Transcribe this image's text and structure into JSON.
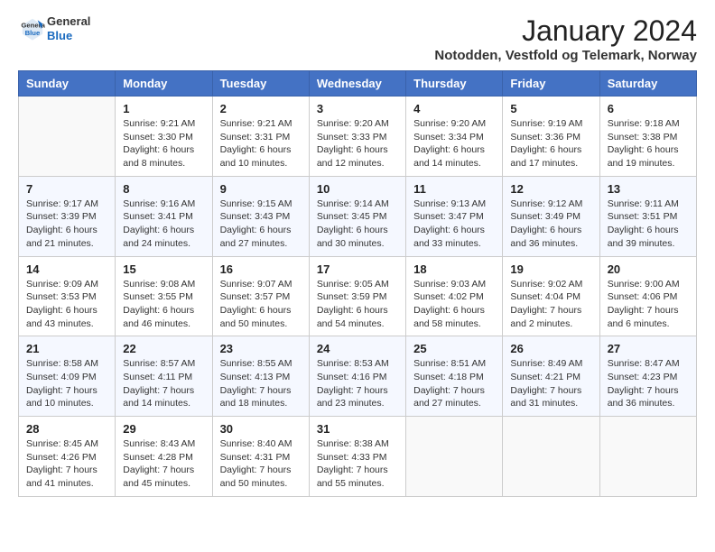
{
  "header": {
    "logo_general": "General",
    "logo_blue": "Blue",
    "title": "January 2024",
    "location": "Notodden, Vestfold og Telemark, Norway"
  },
  "weekdays": [
    "Sunday",
    "Monday",
    "Tuesday",
    "Wednesday",
    "Thursday",
    "Friday",
    "Saturday"
  ],
  "weeks": [
    [
      {
        "day": "",
        "detail": ""
      },
      {
        "day": "1",
        "detail": "Sunrise: 9:21 AM\nSunset: 3:30 PM\nDaylight: 6 hours\nand 8 minutes."
      },
      {
        "day": "2",
        "detail": "Sunrise: 9:21 AM\nSunset: 3:31 PM\nDaylight: 6 hours\nand 10 minutes."
      },
      {
        "day": "3",
        "detail": "Sunrise: 9:20 AM\nSunset: 3:33 PM\nDaylight: 6 hours\nand 12 minutes."
      },
      {
        "day": "4",
        "detail": "Sunrise: 9:20 AM\nSunset: 3:34 PM\nDaylight: 6 hours\nand 14 minutes."
      },
      {
        "day": "5",
        "detail": "Sunrise: 9:19 AM\nSunset: 3:36 PM\nDaylight: 6 hours\nand 17 minutes."
      },
      {
        "day": "6",
        "detail": "Sunrise: 9:18 AM\nSunset: 3:38 PM\nDaylight: 6 hours\nand 19 minutes."
      }
    ],
    [
      {
        "day": "7",
        "detail": "Sunrise: 9:17 AM\nSunset: 3:39 PM\nDaylight: 6 hours\nand 21 minutes."
      },
      {
        "day": "8",
        "detail": "Sunrise: 9:16 AM\nSunset: 3:41 PM\nDaylight: 6 hours\nand 24 minutes."
      },
      {
        "day": "9",
        "detail": "Sunrise: 9:15 AM\nSunset: 3:43 PM\nDaylight: 6 hours\nand 27 minutes."
      },
      {
        "day": "10",
        "detail": "Sunrise: 9:14 AM\nSunset: 3:45 PM\nDaylight: 6 hours\nand 30 minutes."
      },
      {
        "day": "11",
        "detail": "Sunrise: 9:13 AM\nSunset: 3:47 PM\nDaylight: 6 hours\nand 33 minutes."
      },
      {
        "day": "12",
        "detail": "Sunrise: 9:12 AM\nSunset: 3:49 PM\nDaylight: 6 hours\nand 36 minutes."
      },
      {
        "day": "13",
        "detail": "Sunrise: 9:11 AM\nSunset: 3:51 PM\nDaylight: 6 hours\nand 39 minutes."
      }
    ],
    [
      {
        "day": "14",
        "detail": "Sunrise: 9:09 AM\nSunset: 3:53 PM\nDaylight: 6 hours\nand 43 minutes."
      },
      {
        "day": "15",
        "detail": "Sunrise: 9:08 AM\nSunset: 3:55 PM\nDaylight: 6 hours\nand 46 minutes."
      },
      {
        "day": "16",
        "detail": "Sunrise: 9:07 AM\nSunset: 3:57 PM\nDaylight: 6 hours\nand 50 minutes."
      },
      {
        "day": "17",
        "detail": "Sunrise: 9:05 AM\nSunset: 3:59 PM\nDaylight: 6 hours\nand 54 minutes."
      },
      {
        "day": "18",
        "detail": "Sunrise: 9:03 AM\nSunset: 4:02 PM\nDaylight: 6 hours\nand 58 minutes."
      },
      {
        "day": "19",
        "detail": "Sunrise: 9:02 AM\nSunset: 4:04 PM\nDaylight: 7 hours\nand 2 minutes."
      },
      {
        "day": "20",
        "detail": "Sunrise: 9:00 AM\nSunset: 4:06 PM\nDaylight: 7 hours\nand 6 minutes."
      }
    ],
    [
      {
        "day": "21",
        "detail": "Sunrise: 8:58 AM\nSunset: 4:09 PM\nDaylight: 7 hours\nand 10 minutes."
      },
      {
        "day": "22",
        "detail": "Sunrise: 8:57 AM\nSunset: 4:11 PM\nDaylight: 7 hours\nand 14 minutes."
      },
      {
        "day": "23",
        "detail": "Sunrise: 8:55 AM\nSunset: 4:13 PM\nDaylight: 7 hours\nand 18 minutes."
      },
      {
        "day": "24",
        "detail": "Sunrise: 8:53 AM\nSunset: 4:16 PM\nDaylight: 7 hours\nand 23 minutes."
      },
      {
        "day": "25",
        "detail": "Sunrise: 8:51 AM\nSunset: 4:18 PM\nDaylight: 7 hours\nand 27 minutes."
      },
      {
        "day": "26",
        "detail": "Sunrise: 8:49 AM\nSunset: 4:21 PM\nDaylight: 7 hours\nand 31 minutes."
      },
      {
        "day": "27",
        "detail": "Sunrise: 8:47 AM\nSunset: 4:23 PM\nDaylight: 7 hours\nand 36 minutes."
      }
    ],
    [
      {
        "day": "28",
        "detail": "Sunrise: 8:45 AM\nSunset: 4:26 PM\nDaylight: 7 hours\nand 41 minutes."
      },
      {
        "day": "29",
        "detail": "Sunrise: 8:43 AM\nSunset: 4:28 PM\nDaylight: 7 hours\nand 45 minutes."
      },
      {
        "day": "30",
        "detail": "Sunrise: 8:40 AM\nSunset: 4:31 PM\nDaylight: 7 hours\nand 50 minutes."
      },
      {
        "day": "31",
        "detail": "Sunrise: 8:38 AM\nSunset: 4:33 PM\nDaylight: 7 hours\nand 55 minutes."
      },
      {
        "day": "",
        "detail": ""
      },
      {
        "day": "",
        "detail": ""
      },
      {
        "day": "",
        "detail": ""
      }
    ]
  ]
}
